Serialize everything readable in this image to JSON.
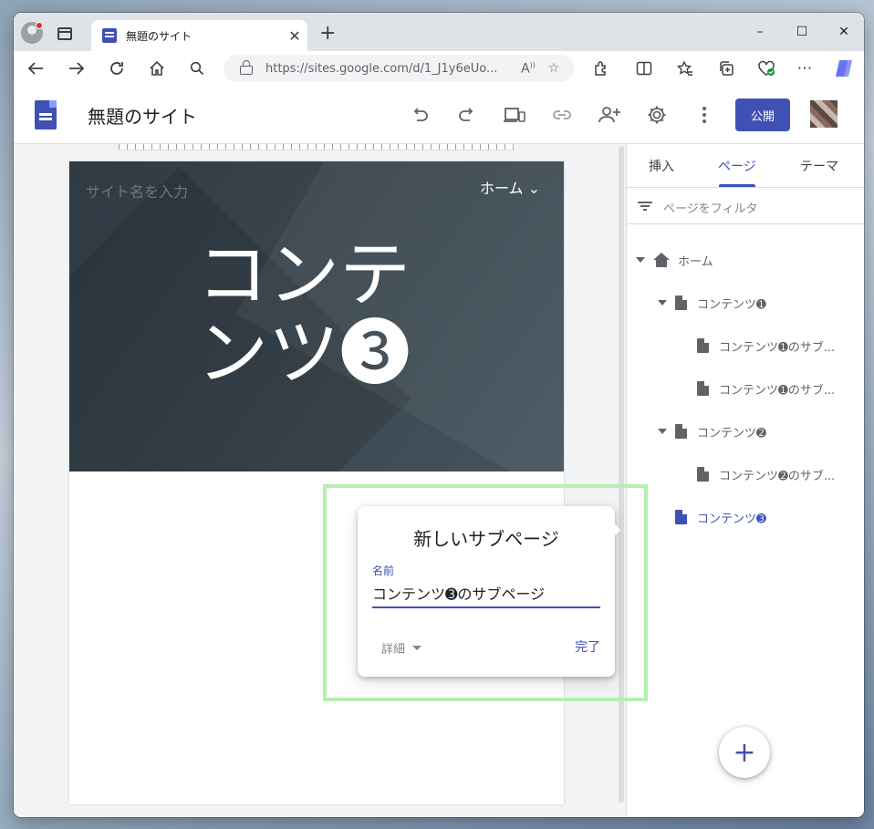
{
  "browser": {
    "tab_title": "無題のサイト",
    "tab_close": "✕",
    "new_tab": "+",
    "window_controls": [
      "–",
      "☐",
      "✕"
    ],
    "url": "https://sites.google.com/d/1_J1y6eUo...",
    "nav_icons": [
      "back-icon",
      "forward-icon",
      "refresh-icon",
      "home-icon",
      "search-icon"
    ],
    "url_icons": [
      "read-aloud-icon",
      "favorite-star-icon"
    ],
    "toolbar_icons": [
      "extensions-icon",
      "split-screen-icon",
      "favorites-icon",
      "collections-icon",
      "browser-essentials-icon",
      "more-icon",
      "copilot-icon"
    ]
  },
  "app": {
    "title": "無題のサイト",
    "publish_label": "公開",
    "header_icons": [
      "undo-icon",
      "redo-icon",
      "preview-icon",
      "link-icon",
      "share-icon",
      "settings-icon",
      "more-vert-icon"
    ]
  },
  "hero": {
    "site_name_placeholder": "サイト名を入力",
    "nav_label": "ホーム ⌄",
    "title": "コンテンツ➌"
  },
  "side_panel": {
    "tabs": [
      "挿入",
      "ページ",
      "テーマ"
    ],
    "active_tab": "ページ",
    "filter_placeholder": "ページをフィルタ",
    "tree": [
      {
        "label": "ホーム",
        "level": 0
      },
      {
        "label": "コンテンツ➊",
        "level": 1
      },
      {
        "label": "コンテンツ➊のサブ...",
        "level": 2
      },
      {
        "label": "コンテンツ➊のサブ...",
        "level": 2
      },
      {
        "label": "コンテンツ➋",
        "level": 1
      },
      {
        "label": "コンテンツ➋のサブ...",
        "level": 2
      },
      {
        "label": "コンテンツ➌",
        "level": 1,
        "active": true
      }
    ],
    "fab_label": "+"
  },
  "dialog": {
    "title": "新しいサブページ",
    "name_label": "名前",
    "name_value": "コンテンツ➌のサブページ",
    "details_label": "詳細",
    "done_label": "完了"
  },
  "colors": {
    "accent": "#3f51b5",
    "highlight": "#b5f0b0",
    "hero_bg": "#37424b"
  }
}
